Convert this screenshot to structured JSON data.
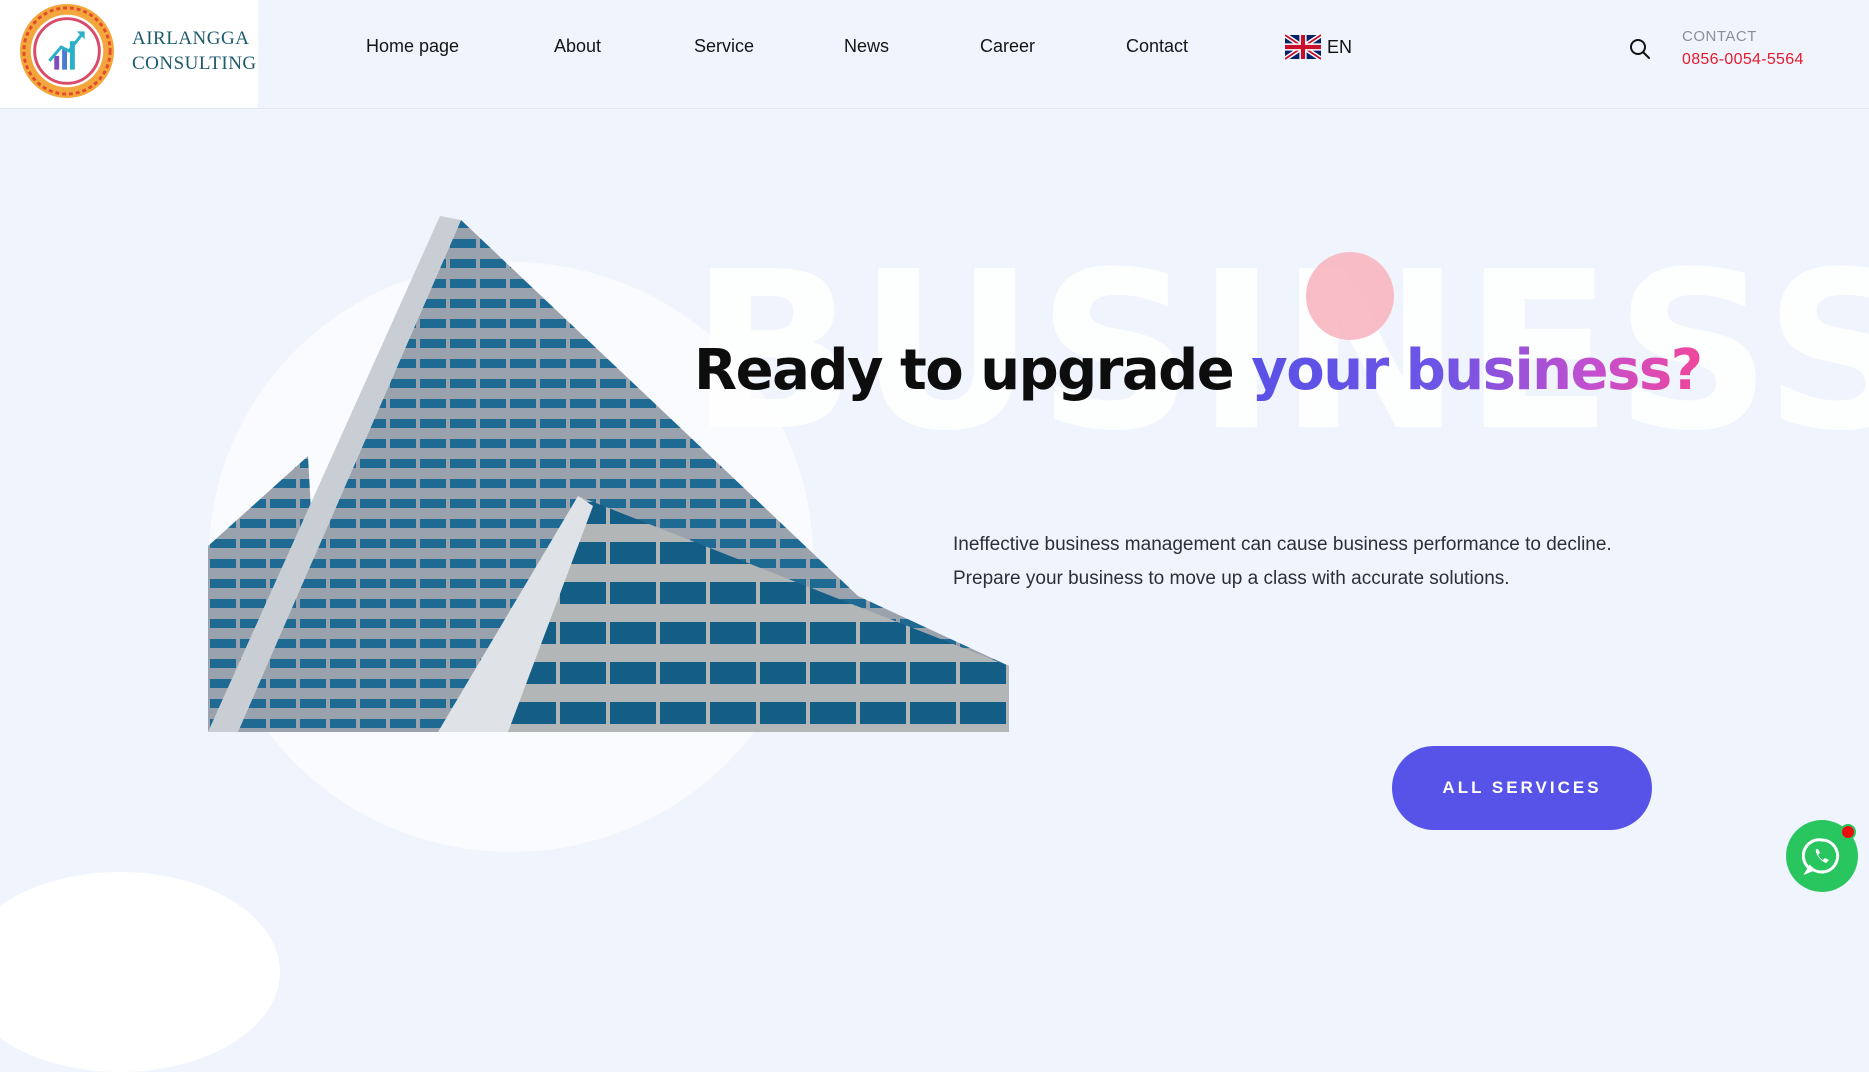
{
  "brand": {
    "line1": "AIRLANGGA",
    "line2": "CONSULTING"
  },
  "nav": {
    "items": [
      {
        "label": "Home page"
      },
      {
        "label": "About"
      },
      {
        "label": "Service"
      },
      {
        "label": "News"
      },
      {
        "label": "Career"
      },
      {
        "label": "Contact"
      }
    ],
    "language": "EN"
  },
  "contact": {
    "label": "CONTACT",
    "phone": "0856-0054-5564"
  },
  "hero": {
    "background_word": "BUSINESS",
    "headline_plain": "Ready to upgrade ",
    "headline_highlight": "your business?",
    "description_line1": "Ineffective business management can cause business performance to decline.",
    "description_line2": "Prepare your business to move up a class with accurate solutions.",
    "cta_label": "ALL SERVICES"
  },
  "colors": {
    "accent": "#5753e8",
    "phone": "#e8192c",
    "whatsapp": "#29c660",
    "background": "#eff4fd"
  },
  "icons": {
    "search": "search-icon",
    "flag": "uk-flag-icon",
    "whatsapp": "whatsapp-icon"
  }
}
